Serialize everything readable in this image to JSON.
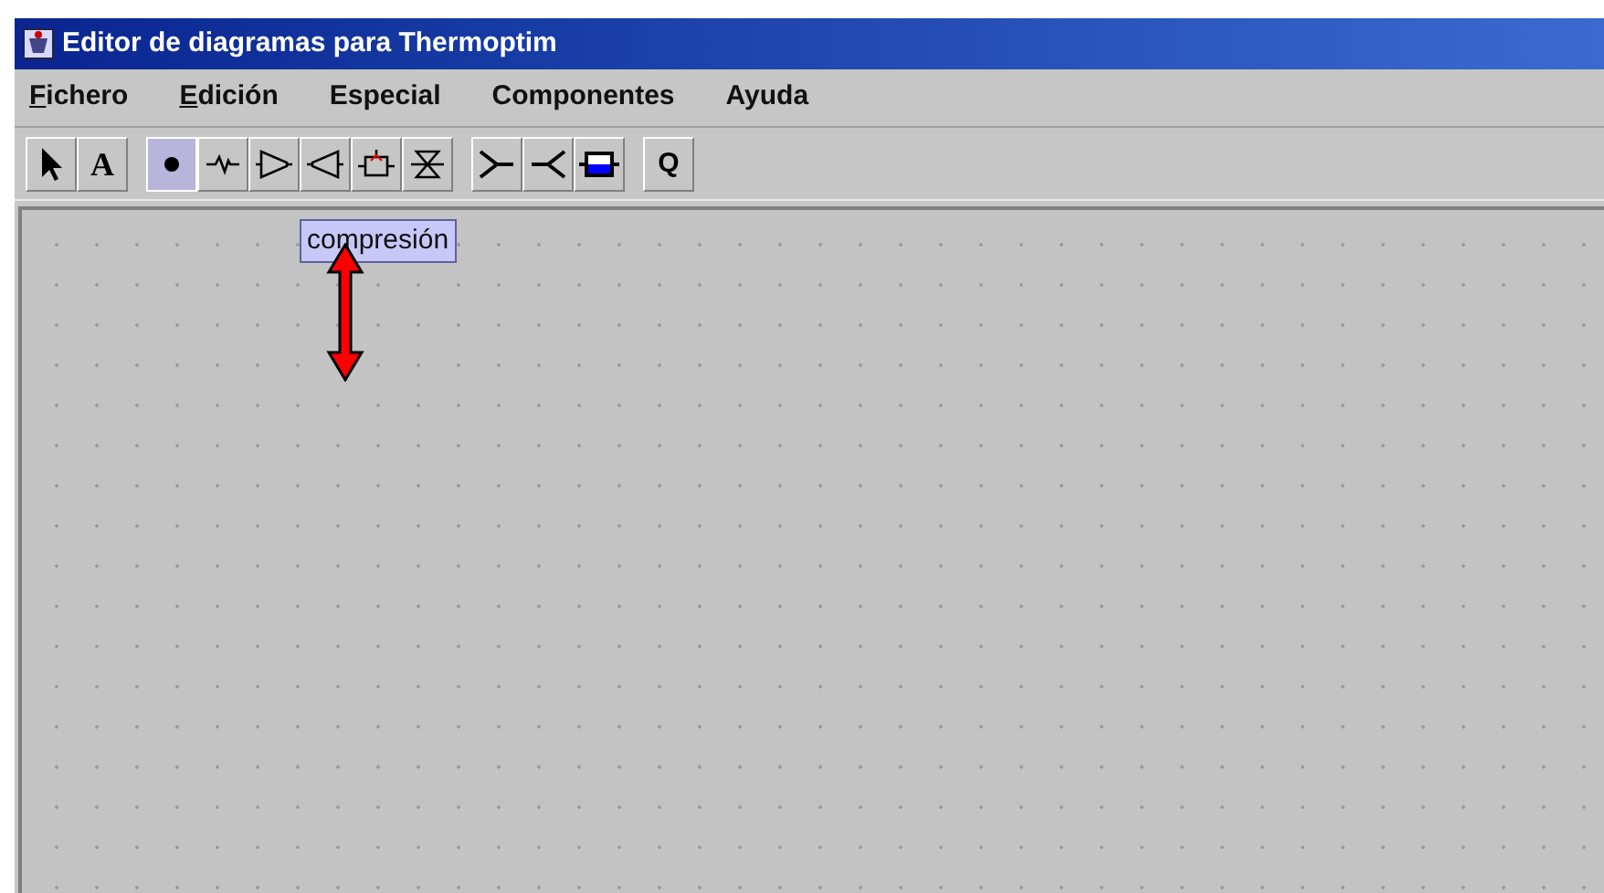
{
  "window": {
    "title": "Editor de diagramas para Thermoptim"
  },
  "menu": [
    {
      "label": "Fichero",
      "mnemonic": true
    },
    {
      "label": "Edición",
      "mnemonic": true
    },
    {
      "label": "Especial",
      "mnemonic": false
    },
    {
      "label": "Componentes",
      "mnemonic": false
    },
    {
      "label": "Ayuda",
      "mnemonic": false
    }
  ],
  "toolbar": [
    [
      {
        "kind": "pointer",
        "selected": false
      },
      {
        "kind": "text",
        "label": "A",
        "selected": false
      }
    ],
    [
      {
        "kind": "point",
        "selected": true
      },
      {
        "kind": "exchange",
        "selected": false
      },
      {
        "kind": "compressor",
        "selected": false
      },
      {
        "kind": "turbine",
        "selected": false
      },
      {
        "kind": "combustion",
        "selected": false
      },
      {
        "kind": "valve",
        "selected": false
      }
    ],
    [
      {
        "kind": "mixer",
        "selected": false
      },
      {
        "kind": "divider",
        "selected": false
      },
      {
        "kind": "node",
        "selected": false
      }
    ],
    [
      {
        "kind": "heat",
        "label": "Q",
        "selected": false
      }
    ]
  ],
  "canvas": {
    "tooltip": "compresión"
  }
}
